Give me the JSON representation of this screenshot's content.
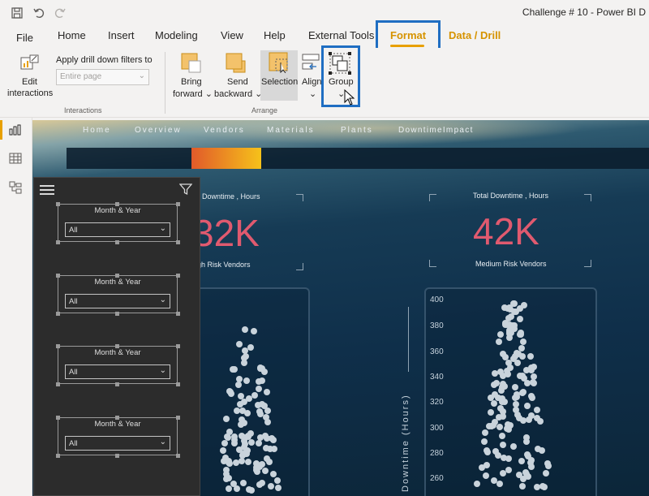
{
  "window": {
    "title": "Challenge # 10 - Power BI D"
  },
  "quick_access": {
    "save_icon": "save-icon",
    "undo_icon": "undo-icon",
    "redo_icon": "redo-icon"
  },
  "ribbon_tabs": [
    "File",
    "Home",
    "Insert",
    "Modeling",
    "View",
    "Help",
    "External Tools",
    "Format",
    "Data / Drill"
  ],
  "active_tab": "Format",
  "ribbon": {
    "edit_interactions": {
      "line1": "Edit",
      "line2": "interactions"
    },
    "apply_drill_label": "Apply drill down filters to",
    "apply_drill_value": "Entire page",
    "interactions_group": "Interactions",
    "bring_forward": {
      "line1": "Bring",
      "line2": "forward"
    },
    "send_backward": {
      "line1": "Send",
      "line2": "backward"
    },
    "selection": "Selection",
    "align": "Align",
    "group": "Group",
    "arrange_group": "Arrange"
  },
  "report": {
    "nav": [
      "Home",
      "Overview",
      "Vendors",
      "Materials",
      "Plants",
      "DowntimeImpact"
    ],
    "active_nav": "Vendors",
    "kpi_left": {
      "title": "Downtime , Hours",
      "value": "32K",
      "subtitle": "igh Risk Vendors"
    },
    "kpi_right": {
      "title": "Total Downtime , Hours",
      "value": "42K",
      "subtitle": "Medium Risk Vendors"
    },
    "y_axis_label": "Downtime (Hours)",
    "y_ticks": [
      "400",
      "380",
      "360",
      "340",
      "320",
      "300",
      "280",
      "260"
    ]
  },
  "slicers": [
    {
      "title": "Month & Year",
      "value": "All"
    },
    {
      "title": "Month & Year",
      "value": "All"
    },
    {
      "title": "Month & Year",
      "value": "All"
    },
    {
      "title": "Month & Year",
      "value": "All"
    }
  ],
  "colors": {
    "accent": "#e8a000",
    "highlight": "#1f6ec2",
    "kpi": "#e05a6f"
  }
}
